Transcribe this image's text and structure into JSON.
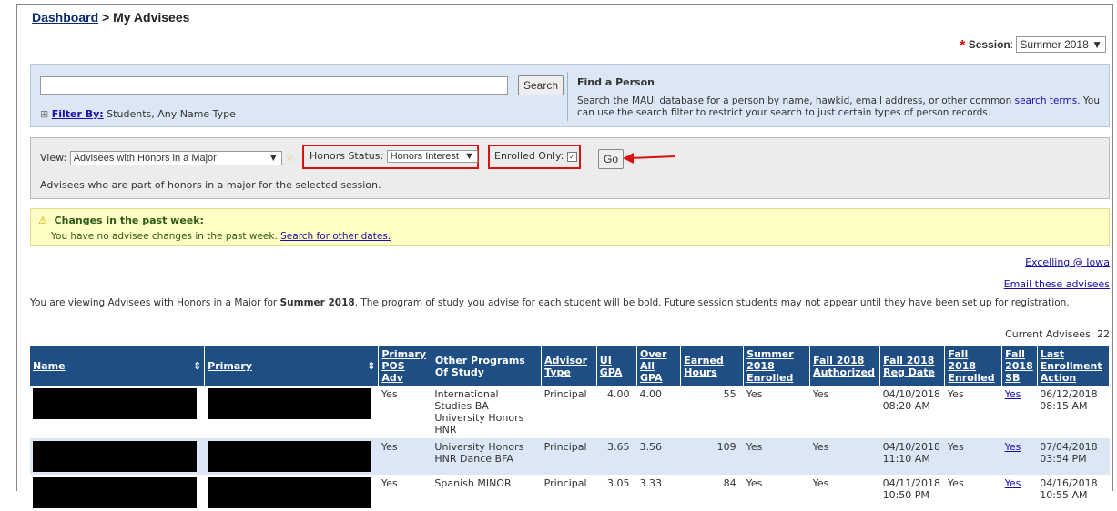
{
  "breadcrumb": {
    "link": "Dashboard",
    "sep": " > ",
    "current": "My Advisees"
  },
  "session": {
    "label": "Session",
    "value": "Summer 2018 ▼"
  },
  "search": {
    "button": "Search",
    "filter_label": "Filter By:",
    "filter_value": "Students, Any Name Type",
    "find_title": "Find a Person",
    "find_text_1": "Search the MAUI database for a person by name, hawkid, email address, or other common ",
    "find_link": "search terms",
    "find_text_2": ". You can use the search filter to restrict your search to just certain types of person records."
  },
  "view": {
    "label": "View:",
    "value": "Advisees with Honors in a Major",
    "honors_label": "Honors Status:",
    "honors_value": "Honors Interest",
    "enrolled_label": "Enrolled Only:",
    "go": "Go",
    "desc": "Advisees who are part of honors in a major for the selected session."
  },
  "changes": {
    "title": "Changes in the past week:",
    "text": "You have no advisee changes in the past week. ",
    "link": "Search for other dates."
  },
  "links": {
    "excelling": "Excelling @ Iowa",
    "email": "Email these advisees"
  },
  "viewing": {
    "pre": "You are viewing Advisees with Honors in a Major for ",
    "session": "Summer 2018",
    "post": ".  The program of study you advise for each student will be bold.  Future session students may not appear until they have been set up for registration."
  },
  "current": "Current Advisees: 22",
  "table": {
    "headers": [
      "Name",
      "Primary",
      "Primary POS Adv",
      "Other Programs Of Study",
      "Advisor Type",
      "UI GPA",
      "Over All GPA",
      "Earned Hours",
      "Summer 2018 Enrolled",
      "Fall 2018 Authorized",
      "Fall 2018 Reg Date",
      "Fall 2018 Enrolled",
      "Fall 2018 SB",
      "Last Enrollment Action"
    ],
    "rows": [
      {
        "pos": "Yes",
        "other": "International Studies BA University Honors HNR",
        "type": "Principal",
        "ui": "4.00",
        "all": "4.00",
        "hours": "55",
        "summer": "Yes",
        "auth": "Yes",
        "reg": "04/10/2018 08:20 AM",
        "enr": "Yes",
        "sb": "Yes",
        "last": "06/12/2018 08:15 AM"
      },
      {
        "pos": "Yes",
        "other": "University Honors HNR Dance BFA",
        "type": "Principal",
        "ui": "3.65",
        "all": "3.56",
        "hours": "109",
        "summer": "Yes",
        "auth": "Yes",
        "reg": "04/10/2018 11:10 AM",
        "enr": "Yes",
        "sb": "Yes",
        "last": "07/04/2018 03:54 PM"
      },
      {
        "pos": "Yes",
        "other": "Spanish MINOR",
        "type": "Principal",
        "ui": "3.05",
        "all": "3.33",
        "hours": "84",
        "summer": "Yes",
        "auth": "Yes",
        "reg": "04/11/2018 10:50 PM",
        "enr": "Yes",
        "sb": "Yes",
        "last": "04/16/2018 10:55 AM"
      }
    ]
  },
  "colors": {
    "header_bg": "#1f4e85",
    "alt_row": "#dce7f5",
    "highlight": "#d11111"
  }
}
